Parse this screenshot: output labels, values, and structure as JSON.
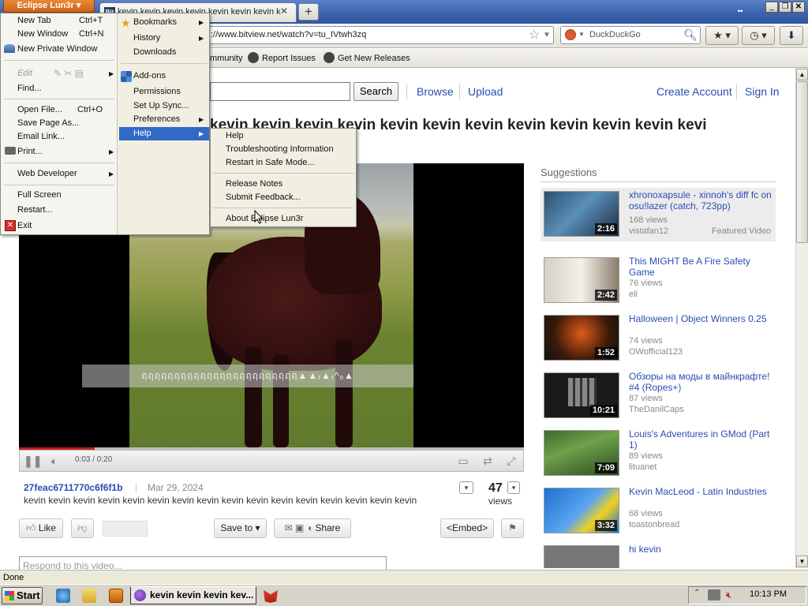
{
  "browser": {
    "app_button": "Eclipse Lun3r",
    "tab_title": "kevin kevin kevin kevin kevin kevin kevin k",
    "tab_favicon": "Bit",
    "url": "http://www.bitview.net/watch?v=tu_IVtwh3zq",
    "url_visible": "://www.bitview.net/watch?v=tu_IVtwh3zq",
    "search_engine": "DuckDuckGo",
    "bookmarks": [
      "Community",
      "Report Issues",
      "Get New Releases"
    ],
    "bookmarks_visible_first": "mmunity",
    "status": "Done"
  },
  "menu": {
    "left": {
      "new_tab": "New Tab",
      "new_tab_key": "Ctrl+T",
      "new_window": "New Window",
      "new_window_key": "Ctrl+N",
      "new_private": "New Private Window",
      "edit": "Edit",
      "find": "Find...",
      "open_file": "Open File...",
      "open_file_key": "Ctrl+O",
      "save_page": "Save Page As...",
      "email_link": "Email Link...",
      "print": "Print...",
      "web_developer": "Web Developer",
      "full_screen": "Full Screen",
      "restart": "Restart...",
      "exit": "Exit"
    },
    "right": {
      "bookmarks": "Bookmarks",
      "history": "History",
      "downloads": "Downloads",
      "addons": "Add-ons",
      "permissions": "Permissions",
      "setup_sync": "Set Up Sync...",
      "preferences": "Preferences",
      "help": "Help"
    },
    "help_submenu": {
      "help": "Help",
      "troubleshooting": "Troubleshooting Information",
      "safe_mode": "Restart in Safe Mode...",
      "release_notes": "Release Notes",
      "submit_feedback": "Submit Feedback...",
      "about": "About Eclipse Lun3r"
    }
  },
  "site": {
    "search_button": "Search",
    "browse": "Browse",
    "upload": "Upload",
    "create_account": "Create Account",
    "sign_in": "Sign In"
  },
  "video": {
    "title": "kevin kevin kevin kevin kevin kevin kevin kevin kevin kevin kevin kevi",
    "subtitle_text": "ฤฤฤฤฤฤฤฤฤฤฤฤฤฤฤฤฤฤฤฤฤฤฤฤ▲▲ᵣ▲ᵣ^ₒ▲",
    "time": "0:03 / 0:20",
    "progress_fraction": 0.15,
    "uploader": "27feac6711770c6f6f1b",
    "date": "Mar 29, 2024",
    "description": "kevin kevin kevin kevin kevin kevin kevin kevin kevin kevin kevin kevin kevin kevin kevin kevin",
    "views": "47",
    "views_label": "views",
    "like": "Like",
    "save_to": "Save to",
    "share": "Share",
    "embed": "<Embed>",
    "comment_placeholder": "Respond to this video..."
  },
  "suggestions": {
    "heading": "Suggestions",
    "items": [
      {
        "title": "xhronoxapsule - xinnoh's diff fc on osu!lazer (catch, 723pp)",
        "views": "168 views",
        "author": "vistafan12",
        "duration": "2:16",
        "featured": "Featured Video"
      },
      {
        "title": "This MIGHT Be A Fire Safety Game",
        "views": "76 views",
        "author": "eli",
        "duration": "2:42"
      },
      {
        "title": "Halloween | Object Winners 0.25",
        "views": "74 views",
        "author": "OWofficial123",
        "duration": "1:52"
      },
      {
        "title": "Обзоры на моды в майнкрафте! #4 (Ropes+)",
        "views": "87 views",
        "author": "TheDanilCaps",
        "duration": "10:21"
      },
      {
        "title": "Louis's Adventures in GMod (Part 1)",
        "views": "89 views",
        "author": "lituanet",
        "duration": "7:09"
      },
      {
        "title": "Kevin MacLeod - Latin Industries",
        "views": "68 views",
        "author": "toastonbread",
        "duration": "3:32"
      },
      {
        "title": "hi kevin",
        "views": "",
        "author": "",
        "duration": ""
      }
    ]
  },
  "taskbar": {
    "start": "Start",
    "task": "kevin kevin kevin kev...",
    "clock": "10:13 PM"
  }
}
